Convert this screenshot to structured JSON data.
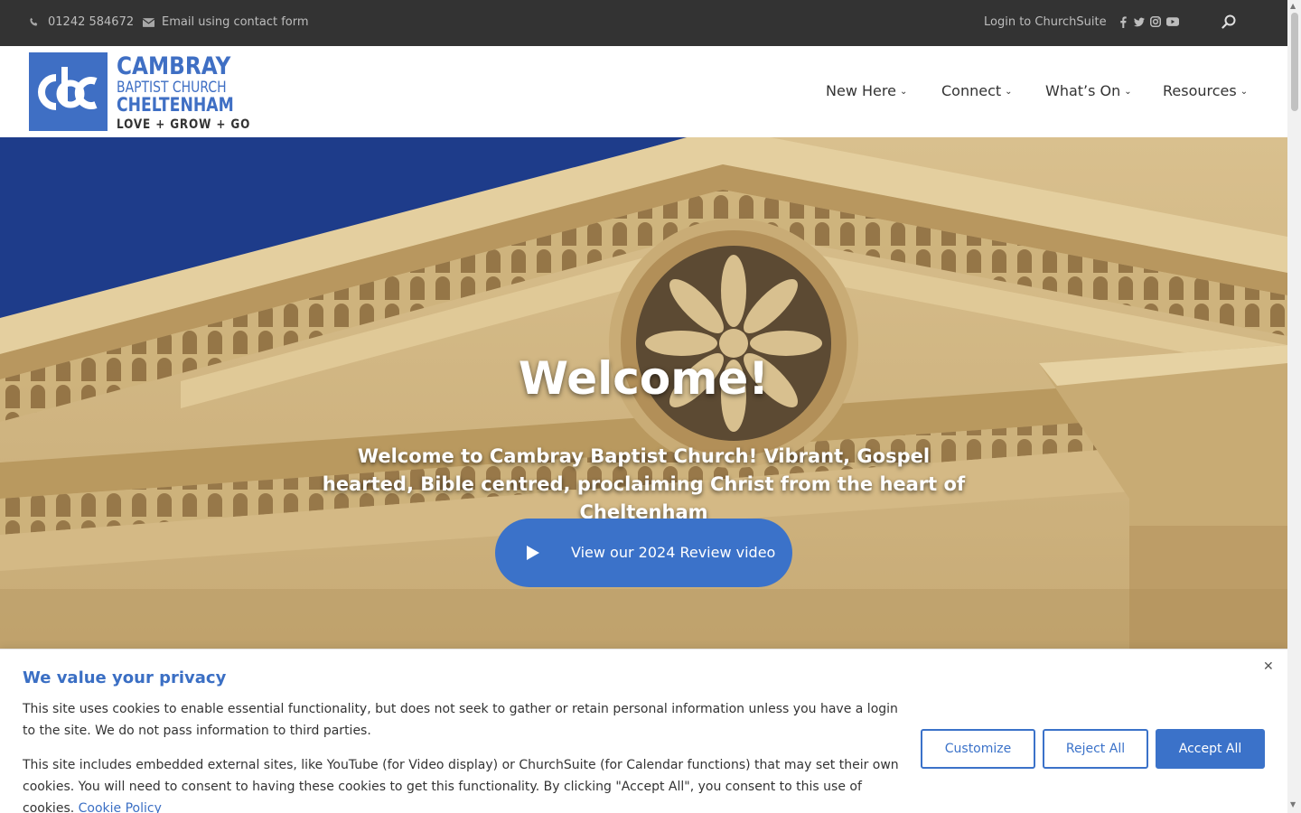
{
  "topbar": {
    "phone": "01242 584672",
    "email": "Email using contact form",
    "login": "Login to ChurchSuite",
    "social_icons": [
      "facebook-icon",
      "twitter-icon",
      "instagram-icon",
      "youtube-icon"
    ]
  },
  "logo": {
    "mark": "cbc",
    "line1": "CAMBRAY",
    "line2": "BAPTIST CHURCH",
    "line3": "CHELTENHAM",
    "tagline": "LOVE + GROW + GO"
  },
  "nav": {
    "items": [
      {
        "label": "New Here"
      },
      {
        "label": "Connect"
      },
      {
        "label": "What’s On"
      },
      {
        "label": "Resources"
      }
    ]
  },
  "hero": {
    "title": "Welcome!",
    "subtitle": "Welcome to Cambray Baptist Church! Vibrant, Gospel hearted, Bible centred, proclaiming Christ from the heart of Cheltenham",
    "video_button": "View our 2024 Review video"
  },
  "cookie": {
    "title": "We value your privacy",
    "para1": "This site uses cookies to enable essential functionality, but does not seek to gather or retain personal information unless you have a login to the site. We do not pass information to third parties.",
    "para2": "This site includes embedded external sites, like YouTube (for Video display) or ChurchSuite (for Calendar functions) that may set their own cookies. You will need to consent to having these cookies to get this functionality.  By clicking \"Accept All\", you consent to this use of cookies.",
    "policy_link": "Cookie Policy",
    "customize": "Customize",
    "reject": "Reject All",
    "accept": "Accept All"
  },
  "colors": {
    "brand_blue": "#3f6fc4",
    "button_blue": "#3b72c9",
    "topbar_bg": "#333333"
  }
}
